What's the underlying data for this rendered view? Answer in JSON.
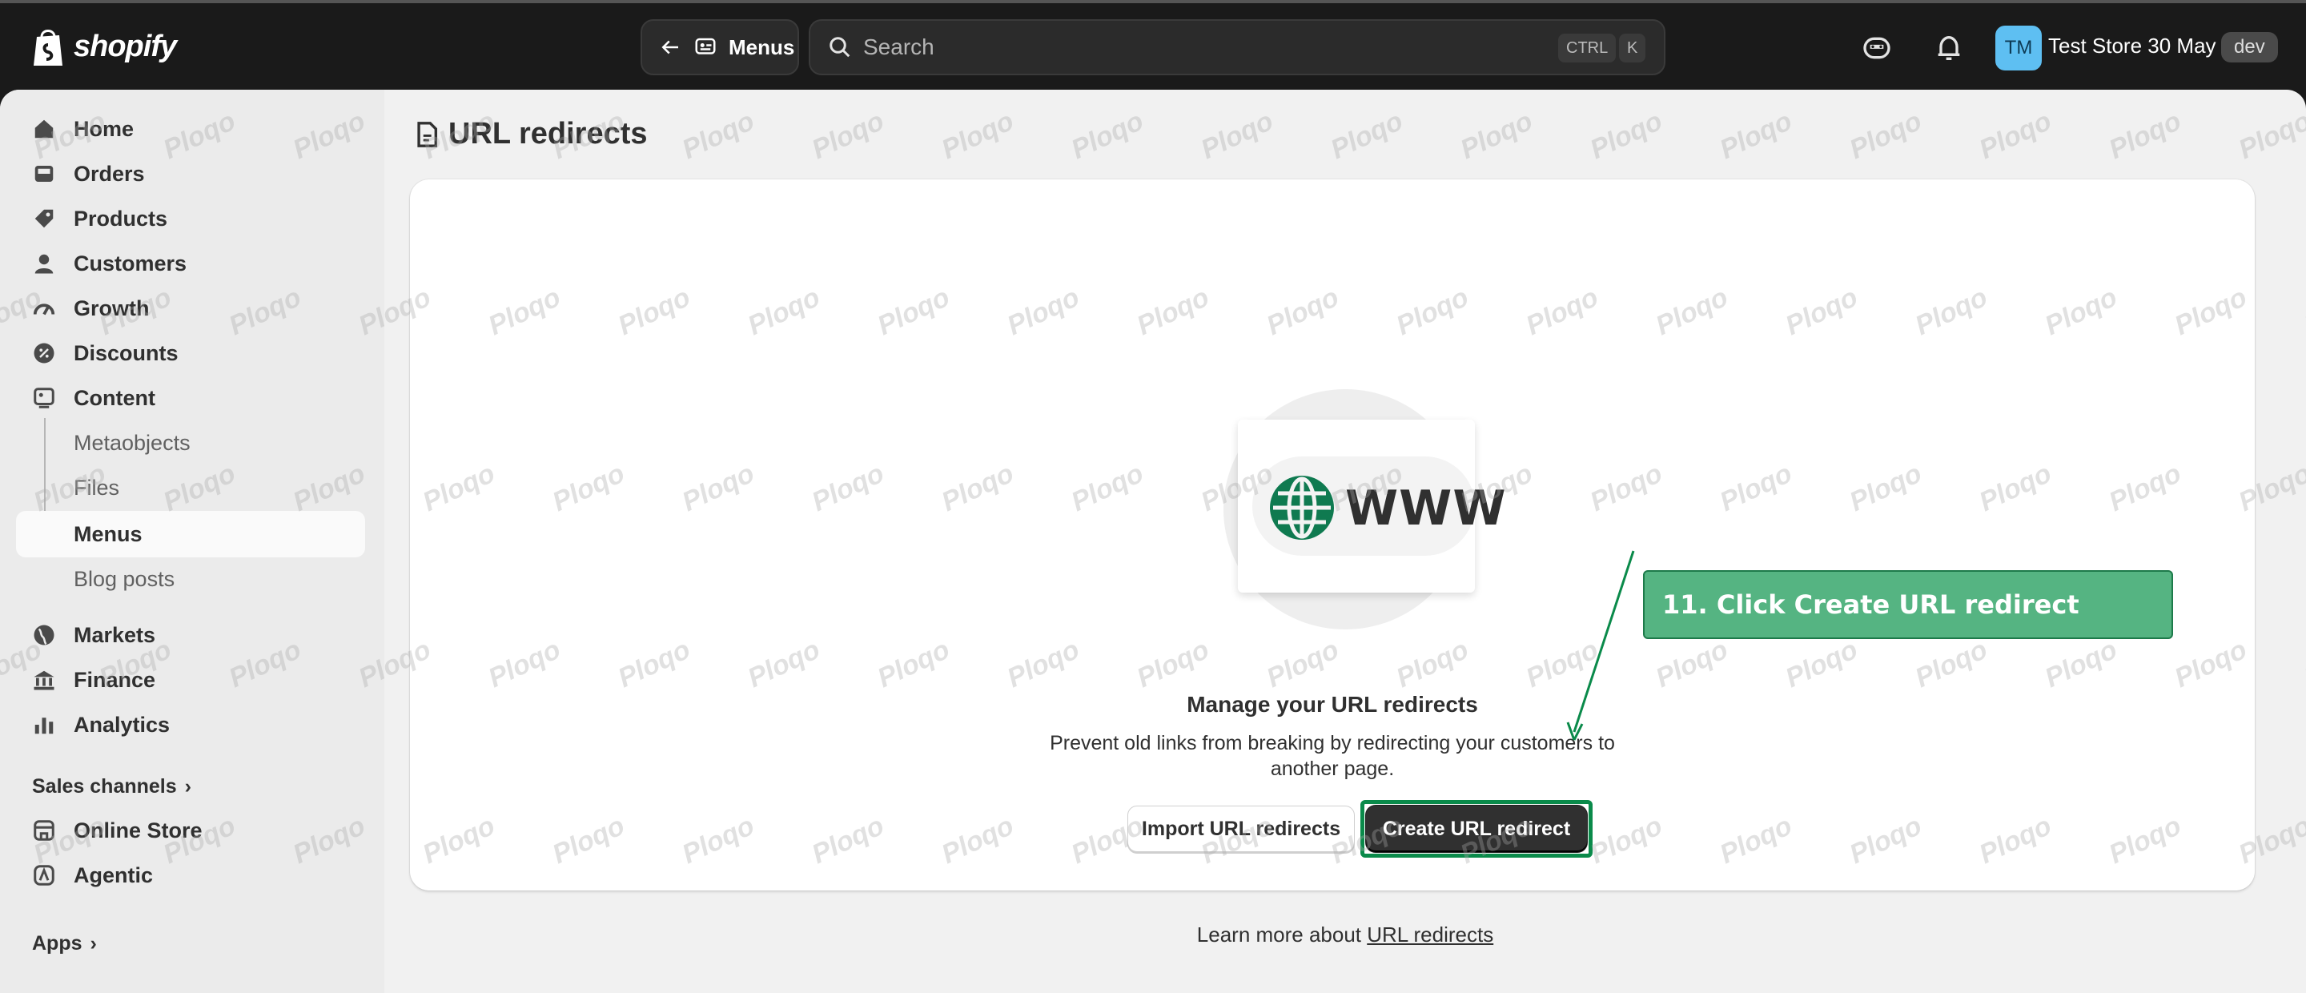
{
  "brand": {
    "name": "shopify"
  },
  "topbar": {
    "back_label": "Menus",
    "search_placeholder": "Search",
    "shortcut_key1": "CTRL",
    "shortcut_key2": "K",
    "avatar_initials": "TM",
    "store_name": "Test Store 30 May",
    "store_badge": "dev"
  },
  "sidebar": {
    "items": [
      {
        "label": "Home",
        "icon": "home-icon"
      },
      {
        "label": "Orders",
        "icon": "inbox-icon"
      },
      {
        "label": "Products",
        "icon": "tag-icon"
      },
      {
        "label": "Customers",
        "icon": "person-icon"
      },
      {
        "label": "Growth",
        "icon": "gauge-icon"
      },
      {
        "label": "Discounts",
        "icon": "discount-icon"
      },
      {
        "label": "Content",
        "icon": "content-icon"
      }
    ],
    "content_sub": [
      "Metaobjects",
      "Files",
      "Menus",
      "Blog posts"
    ],
    "items2": [
      {
        "label": "Markets",
        "icon": "globe-icon"
      },
      {
        "label": "Finance",
        "icon": "bank-icon"
      },
      {
        "label": "Analytics",
        "icon": "chart-icon"
      }
    ],
    "sales_channels_label": "Sales channels",
    "channels": [
      {
        "label": "Online Store",
        "icon": "store-icon"
      },
      {
        "label": "Agentic",
        "icon": "agentic-icon"
      }
    ],
    "apps_label": "Apps"
  },
  "main": {
    "page_title": "URL redirects",
    "illustration_text": "WWW",
    "empty_title": "Manage your URL redirects",
    "empty_desc": "Prevent old links from breaking by redirecting your customers to another page.",
    "import_button": "Import URL redirects",
    "create_button": "Create URL redirect",
    "learn_more_prefix": "Learn more about ",
    "learn_more_link": "URL redirects"
  },
  "annotation": {
    "callout": "11. Click Create URL redirect",
    "color": "#55b482"
  },
  "watermark": "Ploqo"
}
